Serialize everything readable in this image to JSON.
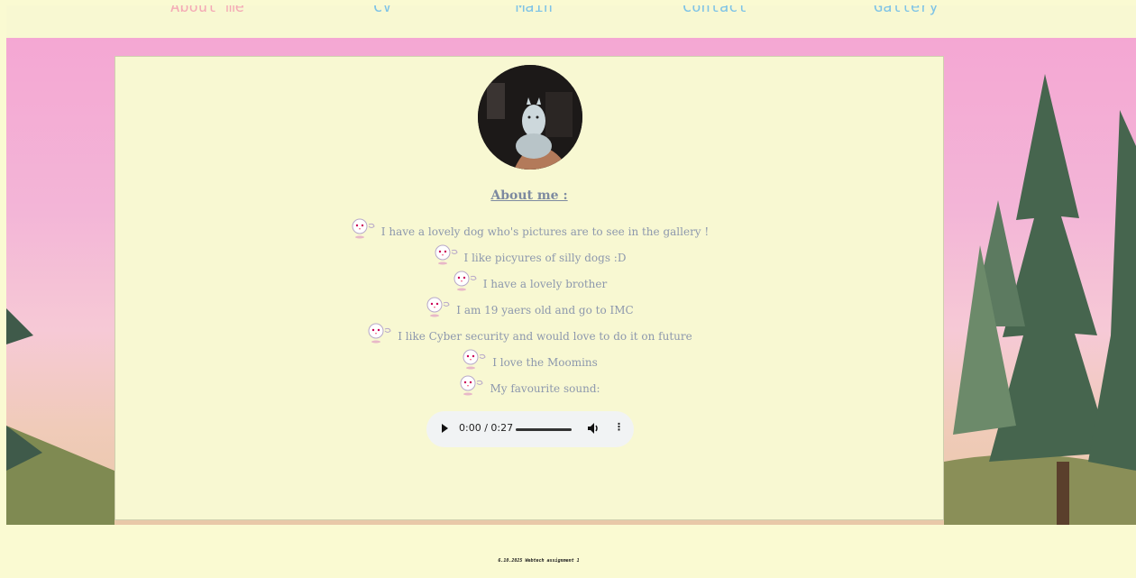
{
  "nav": {
    "items": [
      "About me",
      "CV",
      "Main",
      "Contact",
      "Gallery"
    ]
  },
  "about": {
    "heading": "About me :",
    "lines": [
      "I have a lovely dog who's pictures are to see in the gallery !",
      "I like picyures of silly dogs :D",
      "I have a lovely brother",
      "I am 19 yaers old and go to IMC",
      "I like Cyber security and would love to do it on future",
      "I love the Moomins",
      "My favourite sound:"
    ]
  },
  "audio": {
    "time": "0:00 / 0:27",
    "play_icon": "play-icon",
    "volume_icon": "volume-icon",
    "menu_icon": "more-vert-icon"
  },
  "footer": {
    "text": "6.10.2025 Webtech assignment 1"
  },
  "colors": {
    "page_bg": "#f8f8d2",
    "nav_active": "#f4a9b5",
    "nav_link": "#7ec3e6",
    "text": "#8d98ad"
  }
}
